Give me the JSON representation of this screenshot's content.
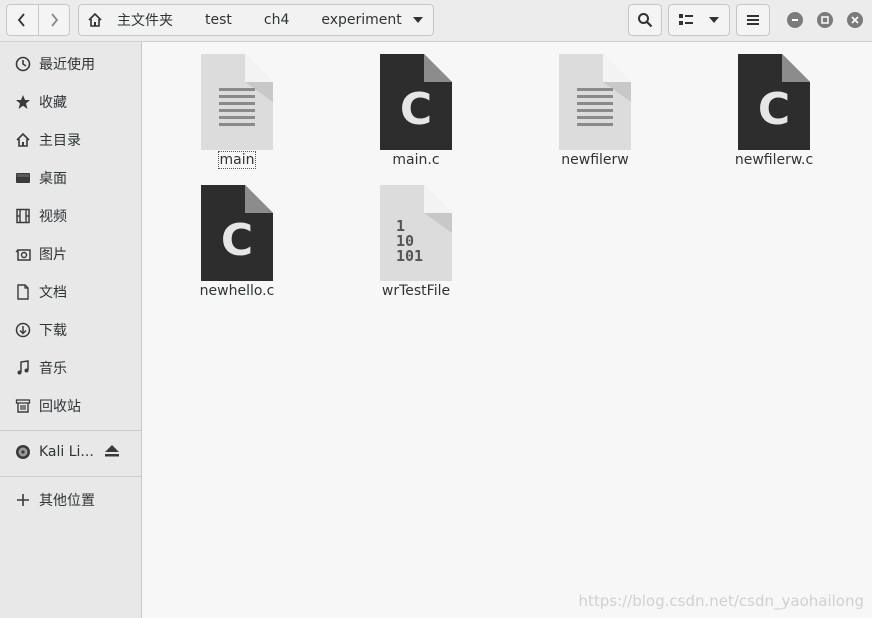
{
  "path": {
    "home": "主文件夹",
    "crumbs": [
      "test",
      "ch4",
      "experiment"
    ]
  },
  "sidebar": {
    "items": [
      {
        "label": "最近使用",
        "icon": "clock-icon"
      },
      {
        "label": "收藏",
        "icon": "star-icon"
      },
      {
        "label": "主目录",
        "icon": "home-icon"
      },
      {
        "label": "桌面",
        "icon": "desktop-icon"
      },
      {
        "label": "视频",
        "icon": "film-icon"
      },
      {
        "label": "图片",
        "icon": "camera-icon"
      },
      {
        "label": "文档",
        "icon": "document-icon"
      },
      {
        "label": "下载",
        "icon": "download-icon"
      },
      {
        "label": "音乐",
        "icon": "music-icon"
      },
      {
        "label": "回收站",
        "icon": "trash-icon"
      }
    ],
    "device": {
      "label": "Kali Li...",
      "icon": "disc-icon",
      "eject_icon": "eject-icon"
    },
    "other": {
      "label": "其他位置",
      "icon": "plus-icon"
    }
  },
  "files": [
    {
      "name": "main",
      "type": "text"
    },
    {
      "name": "main.c",
      "type": "c-source"
    },
    {
      "name": "newfilerw",
      "type": "text"
    },
    {
      "name": "newfilerw.c",
      "type": "c-source"
    },
    {
      "name": "newhello.c",
      "type": "c-source"
    },
    {
      "name": "wrTestFile",
      "type": "binary"
    }
  ],
  "watermark": "https://blog.csdn.net/csdn_yaohailong",
  "colors": {
    "c_icon_bg": "#2d2d2d",
    "text_icon_bg": "#dcdcdc",
    "window_button": "#7b7b7b"
  }
}
